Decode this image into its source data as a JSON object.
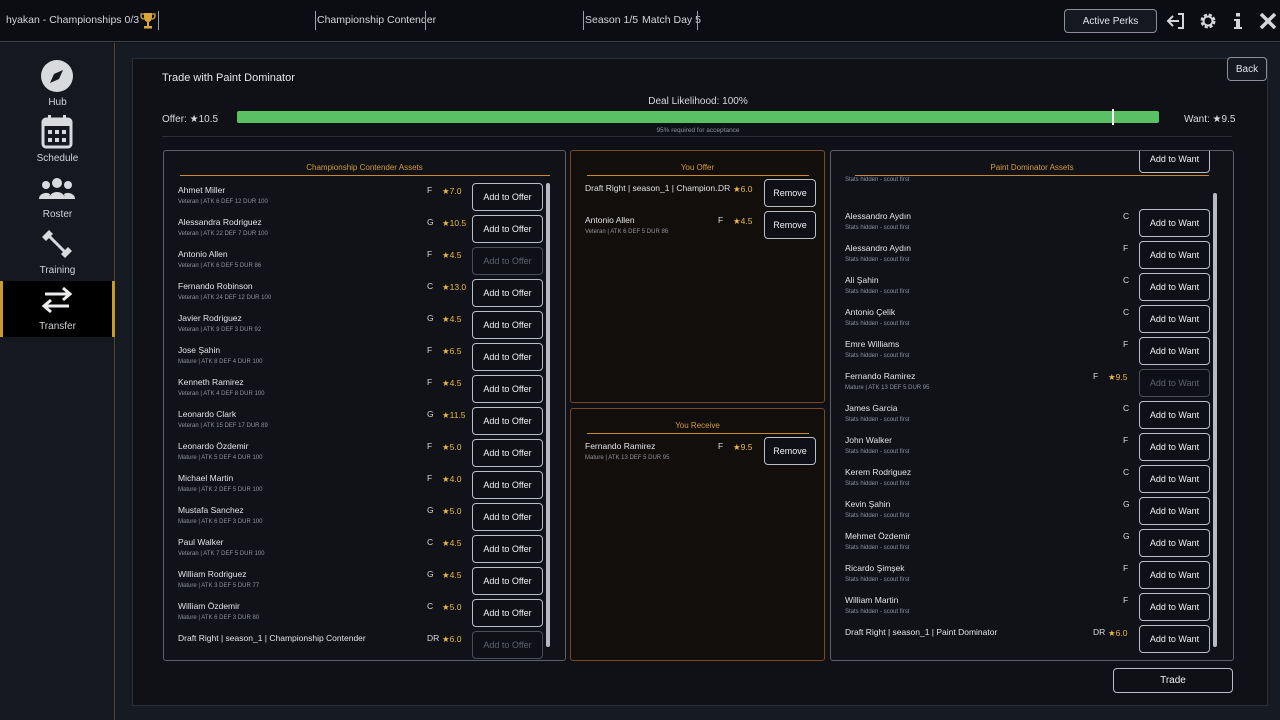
{
  "topbar": {
    "user_label": "hyakan - Championships 0/3",
    "team_name": "Championship Contender",
    "season": "Season 1/5",
    "matchday": "Match Day 5",
    "active_perks": "Active Perks",
    "icons": [
      "trophy-icon",
      "exit-icon",
      "gear-icon",
      "info-icon",
      "close-icon"
    ]
  },
  "sidebar": {
    "items": [
      {
        "label": "Hub",
        "icon": "compass-icon"
      },
      {
        "label": "Schedule",
        "icon": "calendar-icon"
      },
      {
        "label": "Roster",
        "icon": "people-icon"
      },
      {
        "label": "Training",
        "icon": "dumbbell-icon"
      },
      {
        "label": "Transfer",
        "icon": "transfer-arrows-icon",
        "active": true
      }
    ]
  },
  "modal": {
    "title": "Trade with Paint Dominator",
    "back": "Back",
    "deal_likelihood": "Deal Likelihood: 100%",
    "offer_total": "Offer: ★10.5",
    "want_total": "Want: ★9.5",
    "likelihood_fraction": 1.0,
    "threshold_fraction": 0.95,
    "threshold_note": "95% required for acceptance",
    "trade_button": "Trade",
    "accent_color": "#59c064",
    "gold_color": "#d49a3a"
  },
  "my_assets": {
    "title": "Championship Contender Assets",
    "button_label": "Add to Offer",
    "rows": [
      {
        "name": "Ahmet Miller",
        "sub": "Veteran | ATK 6  DEF 12  DUR 100",
        "pos": "F",
        "rating": "★7.0",
        "disabled": false
      },
      {
        "name": "Alessandra Rodriguez",
        "sub": "Veteran | ATK 22  DEF 7  DUR 100",
        "pos": "G",
        "rating": "★10.5",
        "disabled": false
      },
      {
        "name": "Antonio Allen",
        "sub": "Veteran | ATK 6  DEF 5  DUR 86",
        "pos": "F",
        "rating": "★4.5",
        "disabled": true
      },
      {
        "name": "Fernando Robinson",
        "sub": "Veteran | ATK 24  DEF 12  DUR 100",
        "pos": "C",
        "rating": "★13.0",
        "disabled": false
      },
      {
        "name": "Javier Rodriguez",
        "sub": "Veteran | ATK 9  DEF 3  DUR 92",
        "pos": "G",
        "rating": "★4.5",
        "disabled": false
      },
      {
        "name": "Jose Şahin",
        "sub": "Mature | ATK 8  DEF 4  DUR 100",
        "pos": "F",
        "rating": "★6.5",
        "disabled": false
      },
      {
        "name": "Kenneth Ramirez",
        "sub": "Veteran | ATK 4  DEF 8  DUR 100",
        "pos": "F",
        "rating": "★4.5",
        "disabled": false
      },
      {
        "name": "Leonardo Clark",
        "sub": "Veteran | ATK 15  DEF 17  DUR 89",
        "pos": "G",
        "rating": "★11.5",
        "disabled": false
      },
      {
        "name": "Leonardo Özdemir",
        "sub": "Mature | ATK 5  DEF 4  DUR 100",
        "pos": "F",
        "rating": "★5.0",
        "disabled": false
      },
      {
        "name": "Michael Martin",
        "sub": "Mature | ATK 2  DEF 5  DUR 100",
        "pos": "F",
        "rating": "★4.0",
        "disabled": false
      },
      {
        "name": "Mustafa Sanchez",
        "sub": "Mature | ATK 6  DEF 3  DUR 100",
        "pos": "G",
        "rating": "★5.0",
        "disabled": false
      },
      {
        "name": "Paul Walker",
        "sub": "Veteran | ATK 7  DEF 5  DUR 100",
        "pos": "C",
        "rating": "★4.5",
        "disabled": false
      },
      {
        "name": "William Rodriguez",
        "sub": "Mature | ATK 3  DEF 5  DUR 77",
        "pos": "G",
        "rating": "★4.5",
        "disabled": false
      },
      {
        "name": "William Özdemir",
        "sub": "Mature | ATK 6  DEF 3  DUR 80",
        "pos": "C",
        "rating": "★5.0",
        "disabled": false
      },
      {
        "name": "Draft Right | season_1 | Championship Contender",
        "sub": "",
        "pos": "DR",
        "rating": "★6.0",
        "disabled": true
      }
    ]
  },
  "you_offer": {
    "title": "You Offer",
    "button_label": "Remove",
    "rows": [
      {
        "name": "Draft Right | season_1 | Champion...",
        "sub": "",
        "pos": "DR",
        "rating": "★6.0"
      },
      {
        "name": "Antonio Allen",
        "sub": "Veteran | ATK 6  DEF 5  DUR 86",
        "pos": "F",
        "rating": "★4.5"
      }
    ]
  },
  "you_receive": {
    "title": "You Receive",
    "button_label": "Remove",
    "rows": [
      {
        "name": "Fernando Ramirez",
        "sub": "Mature | ATK 13  DEF 5  DUR 95",
        "pos": "F",
        "rating": "★9.5"
      }
    ]
  },
  "their_assets": {
    "title": "Paint Dominator Assets",
    "button_label": "Add to Want",
    "rows": [
      {
        "name": "",
        "sub": "Stats hidden - scout first",
        "pos": "",
        "rating": "",
        "disabled": false,
        "partial": true
      },
      {
        "name": "Alessandro Aydın",
        "sub": "Stats hidden - scout first",
        "pos": "C",
        "rating": "",
        "disabled": false
      },
      {
        "name": "Alessandro Aydın",
        "sub": "Stats hidden - scout first",
        "pos": "F",
        "rating": "",
        "disabled": false
      },
      {
        "name": "Ali Şahin",
        "sub": "Stats hidden - scout first",
        "pos": "C",
        "rating": "",
        "disabled": false
      },
      {
        "name": "Antonio Çelik",
        "sub": "Stats hidden - scout first",
        "pos": "C",
        "rating": "",
        "disabled": false
      },
      {
        "name": "Emre Williams",
        "sub": "Stats hidden - scout first",
        "pos": "F",
        "rating": "",
        "disabled": false
      },
      {
        "name": "Fernando Ramirez",
        "sub": "Mature | ATK 13  DEF 5  DUR 95",
        "pos": "F",
        "rating": "★9.5",
        "disabled": true
      },
      {
        "name": "James Garcia",
        "sub": "Stats hidden - scout first",
        "pos": "C",
        "rating": "",
        "disabled": false
      },
      {
        "name": "John Walker",
        "sub": "Stats hidden - scout first",
        "pos": "F",
        "rating": "",
        "disabled": false
      },
      {
        "name": "Kerem Rodriguez",
        "sub": "Stats hidden - scout first",
        "pos": "C",
        "rating": "",
        "disabled": false
      },
      {
        "name": "Kevin Şahin",
        "sub": "Stats hidden - scout first",
        "pos": "G",
        "rating": "",
        "disabled": false
      },
      {
        "name": "Mehmet Özdemir",
        "sub": "Stats hidden - scout first",
        "pos": "G",
        "rating": "",
        "disabled": false
      },
      {
        "name": "Ricardo Şimşek",
        "sub": "Stats hidden - scout first",
        "pos": "F",
        "rating": "",
        "disabled": false
      },
      {
        "name": "William Martin",
        "sub": "Stats hidden - scout first",
        "pos": "F",
        "rating": "",
        "disabled": false
      },
      {
        "name": "Draft Right | season_1 | Paint Dominator",
        "sub": "",
        "pos": "DR",
        "rating": "★6.0",
        "disabled": false
      }
    ]
  }
}
